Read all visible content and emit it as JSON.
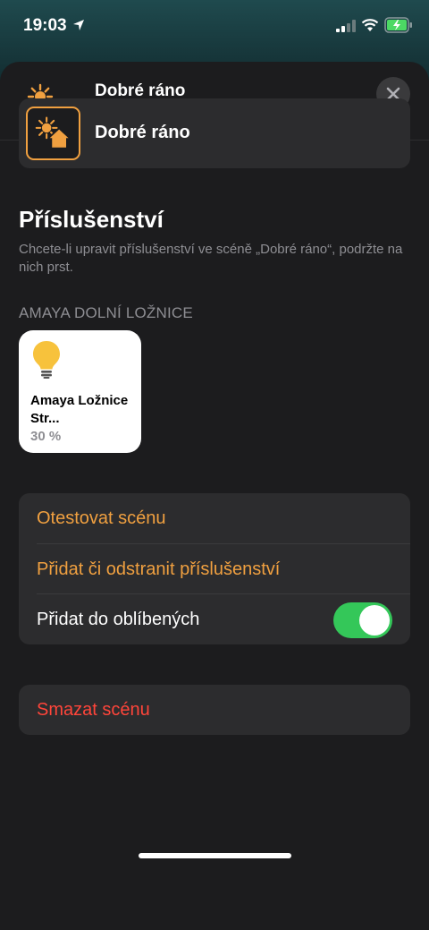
{
  "status_bar": {
    "time": "19:03"
  },
  "header": {
    "title": "Dobré ráno",
    "icon": "sun-house-icon",
    "close_icon": "close-icon"
  },
  "scene": {
    "name": "Dobré ráno",
    "icon": "sun-house-icon",
    "accent": "#f0a040"
  },
  "accessories": {
    "title": "Příslušenství",
    "description": "Chcete-li upravit příslušenství ve scéně „Dobré ráno“, podržte na nich prst.",
    "room": "AMAYA DOLNÍ LOŽNICE",
    "items": [
      {
        "name": "Amaya Ložnice Str...",
        "status": "30 %",
        "icon": "lightbulb-icon"
      }
    ]
  },
  "actions": {
    "test_scene": "Otestovat scénu",
    "add_remove": "Přidat či odstranit příslušenství",
    "favorites": "Přidat do oblíbených",
    "favorites_on": true,
    "toggle_color": "#34c759"
  },
  "delete": {
    "label": "Smazat scénu",
    "color": "#ff453a"
  }
}
